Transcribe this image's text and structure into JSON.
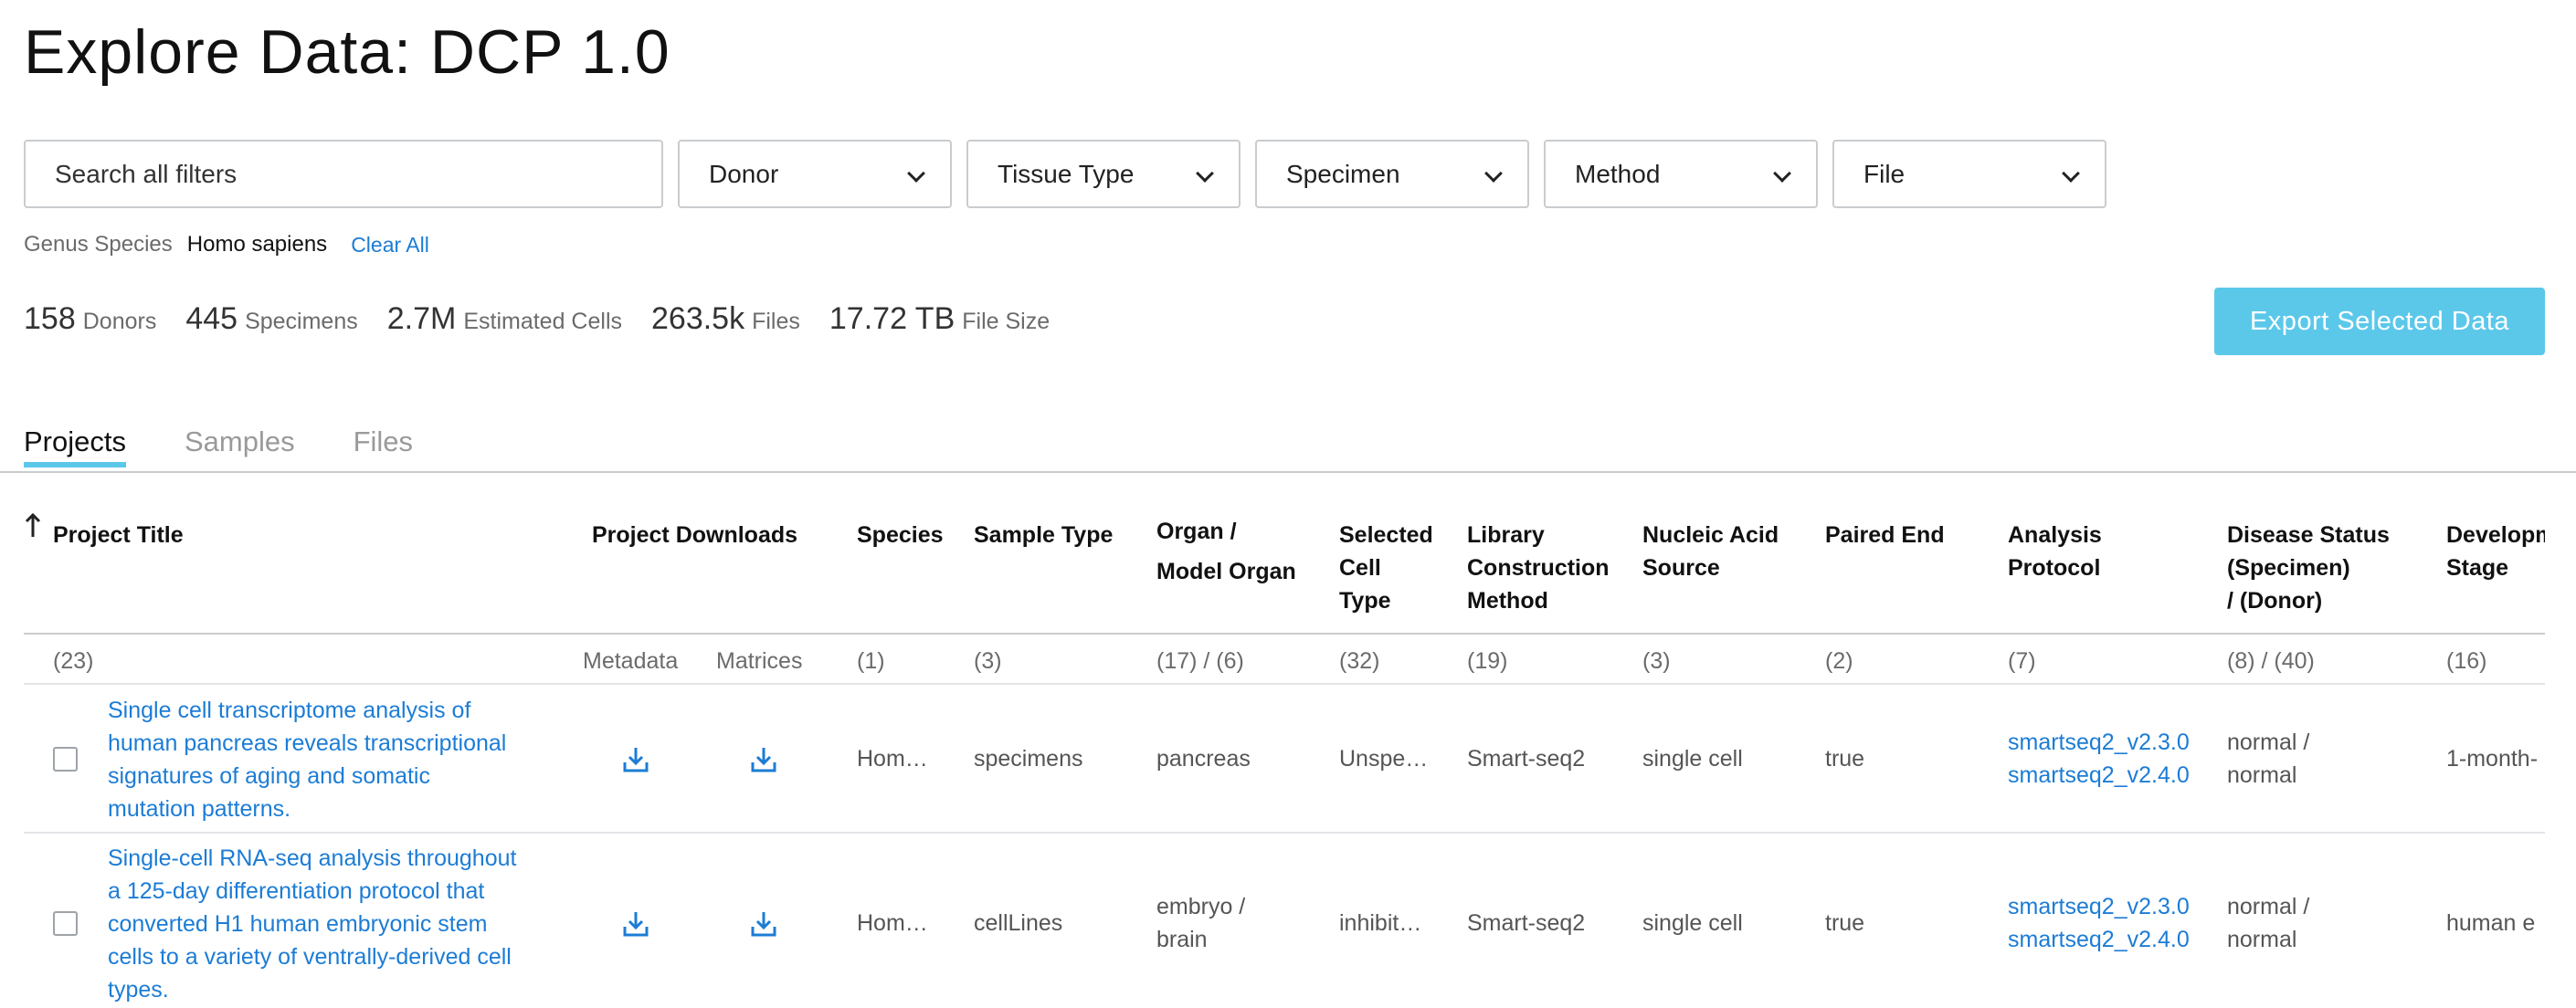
{
  "page": {
    "title": "Explore Data: DCP 1.0"
  },
  "filters": {
    "search_placeholder": "Search all filters",
    "donor": "Donor",
    "tissue_type": "Tissue Type",
    "specimen": "Specimen",
    "method": "Method",
    "file": "File"
  },
  "selected_terms": {
    "label": "Genus Species",
    "value": "Homo sapiens",
    "clear_all": "Clear All"
  },
  "summary": {
    "donors": {
      "count": "158",
      "label": "Donors"
    },
    "specimens": {
      "count": "445",
      "label": "Specimens"
    },
    "cells": {
      "count": "2.7M",
      "label": "Estimated Cells"
    },
    "files": {
      "count": "263.5k",
      "label": "Files"
    },
    "size": {
      "count": "17.72 TB",
      "label": "File Size"
    }
  },
  "export_label": "Export Selected Data",
  "tabs": [
    "Projects",
    "Samples",
    "Files"
  ],
  "columns": {
    "project_title": "Project Title",
    "project_downloads": "Project Downloads",
    "species": "Species",
    "sample_type": "Sample Type",
    "organ": "Organ /\nModel Organ",
    "selected_cell_type": "Selected\nCell\nType",
    "library_method": "Library\nConstruction\nMethod",
    "nucleic_acid": "Nucleic Acid\nSource",
    "paired_end": "Paired End",
    "analysis_protocol": "Analysis\nProtocol",
    "disease_status": "Disease Status\n(Specimen)\n / (Donor)",
    "development_stage": "Developm\nStage"
  },
  "counts": {
    "project_title": "(23)",
    "metadata": "Metadata",
    "matrices": "Matrices",
    "species": "(1)",
    "sample_type": "(3)",
    "organ": "(17) / (6)",
    "selected_cell_type": "(32)",
    "library_method": "(19)",
    "nucleic_acid": "(3)",
    "paired_end": "(2)",
    "analysis_protocol": "(7)",
    "disease_status": "(8) / (40)",
    "development_stage": "(16)"
  },
  "rows": [
    {
      "title_lines": [
        "Single cell transcriptome analysis of",
        "human pancreas reveals transcriptional",
        "signatures of aging and somatic",
        "mutation patterns."
      ],
      "species": "Hom…",
      "sample_type": "specimens",
      "organ_lines": [
        "pancreas"
      ],
      "cell_type": "Unspe…",
      "library": "Smart-seq2",
      "nucleic": "single cell",
      "paired": "true",
      "protocols": [
        "smartseq2_v2.3.0",
        "smartseq2_v2.4.0"
      ],
      "disease_lines": [
        "normal /",
        "normal"
      ],
      "stage": "1-month-"
    },
    {
      "title_lines": [
        "Single-cell RNA-seq analysis throughout",
        "a 125-day differentiation protocol that",
        "converted H1 human embryonic stem",
        "cells to a variety of ventrally-derived cell",
        "types."
      ],
      "species": "Hom…",
      "sample_type": "cellLines",
      "organ_lines": [
        "embryo /",
        "brain"
      ],
      "cell_type": "inhibit…",
      "library": "Smart-seq2",
      "nucleic": "single cell",
      "paired": "true",
      "protocols": [
        "smartseq2_v2.3.0",
        "smartseq2_v2.4.0"
      ],
      "disease_lines": [
        "normal /",
        "normal"
      ],
      "stage": "human e"
    }
  ]
}
